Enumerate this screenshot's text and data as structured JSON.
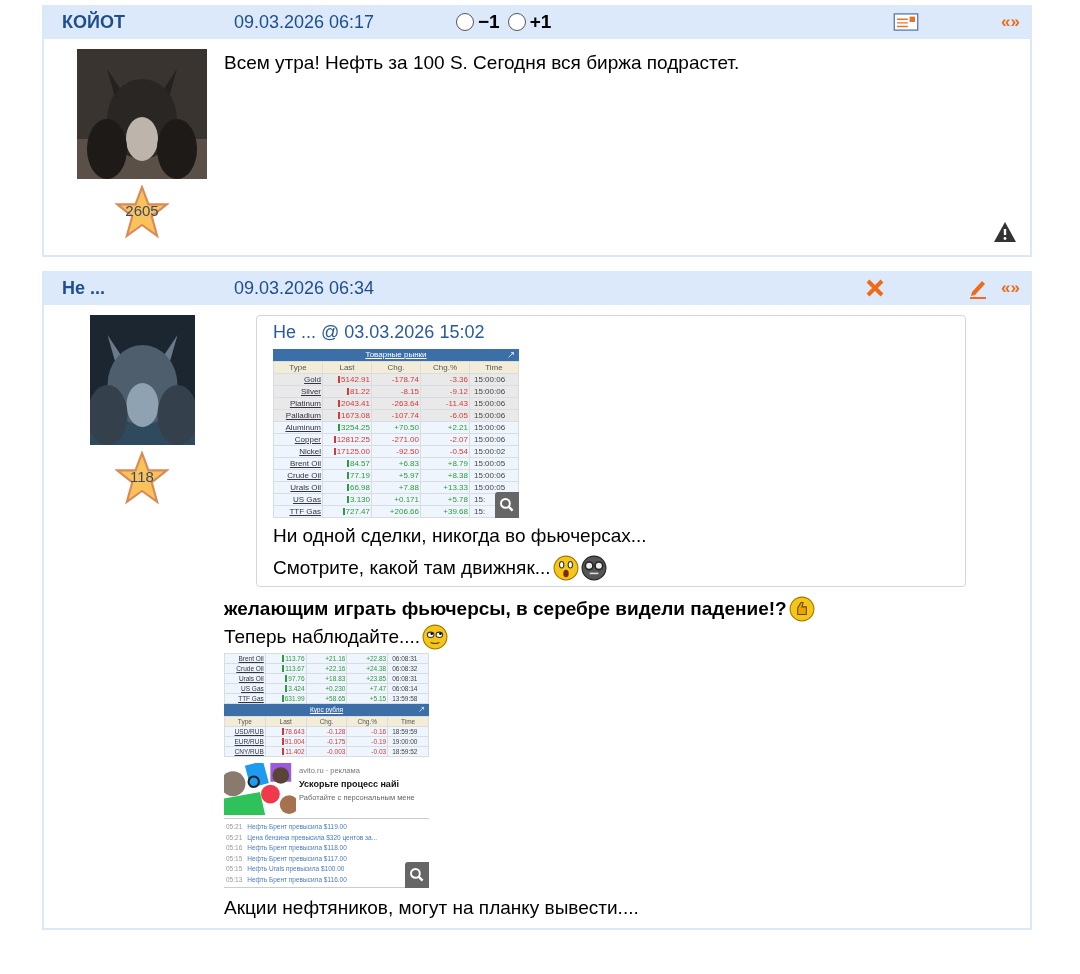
{
  "posts": [
    {
      "author": "КОЙОТ",
      "date": "09.03.2026 06:17",
      "votes": [
        {
          "label": "−1",
          "selected": false
        },
        {
          "label": "+1",
          "selected": false
        }
      ],
      "actions": [
        {
          "kind": "card"
        },
        {
          "kind": "quote",
          "text": "«»"
        }
      ],
      "rating": "2605",
      "footer": [
        {
          "kind": "warning"
        }
      ],
      "blocks": [
        {
          "kind": "text",
          "text": "Всем утра! Нефть за 100 S. Сегодня вся биржа подрастет.",
          "bold": false
        }
      ]
    },
    {
      "author": "Не ...",
      "date": "09.03.2026 06:34",
      "actions": [
        {
          "kind": "delete"
        },
        {
          "kind": "edit"
        },
        {
          "kind": "quote",
          "text": "«»"
        }
      ],
      "rating": "118",
      "blocks": [
        {
          "kind": "quote",
          "heading": "Не ... @ 03.03.2026 15:02",
          "table": {
            "title": "Товарные рынки",
            "columns": [
              "Type",
              "Last",
              "Chg.",
              "Chg.%",
              "Time"
            ],
            "rows": [
              {
                "cells": [
                  "Gold",
                  "5142.91",
                  "-178.74",
                  "-3.36",
                  "15:00:06"
                ],
                "color": "#d23a3a"
              },
              {
                "cells": [
                  "Silver",
                  "81.22",
                  "-8.15",
                  "-9.12",
                  "15:00:06"
                ],
                "color": "#d23a3a"
              },
              {
                "cells": [
                  "Platinum",
                  "2043.41",
                  "-263.64",
                  "-11.43",
                  "15:00:06"
                ],
                "color": "#d23a3a"
              },
              {
                "cells": [
                  "Palladium",
                  "1673.08",
                  "-107.74",
                  "-6.05",
                  "15:00:06"
                ],
                "color": "#d23a3a"
              },
              {
                "cells": [
                  "Aluminum",
                  "3254.25",
                  "+70.50",
                  "+2.21",
                  "15:00:06"
                ],
                "color": "#2f9a3f"
              },
              {
                "cells": [
                  "Copper",
                  "12812.25",
                  "-271.00",
                  "-2.07",
                  "15:00:06"
                ],
                "color": "#d23a3a"
              },
              {
                "cells": [
                  "Nickel",
                  "17125.00",
                  "-92.50",
                  "-0.54",
                  "15:00:02"
                ],
                "color": "#d23a3a"
              },
              {
                "cells": [
                  "Brent Oil",
                  "84.57",
                  "+6.83",
                  "+8.79",
                  "15:00:05"
                ],
                "color": "#2f9a3f"
              },
              {
                "cells": [
                  "Crude Oil",
                  "77.19",
                  "+5.97",
                  "+8.38",
                  "15:00:06"
                ],
                "color": "#2f9a3f"
              },
              {
                "cells": [
                  "Urals Oil",
                  "66.98",
                  "+7.88",
                  "+13.33",
                  "15:00:05"
                ],
                "color": "#2f9a3f"
              },
              {
                "cells": [
                  "US Gas",
                  "3.130",
                  "+0.171",
                  "+5.78",
                  "15:"
                ],
                "color": "#2f9a3f"
              },
              {
                "cells": [
                  "TTF Gas",
                  "727.47",
                  "+206.66",
                  "+39.68",
                  "15:"
                ],
                "color": "#2f9a3f"
              }
            ]
          },
          "lines": [
            {
              "text": "Ни одной сделки, никогда во фьючерсах..."
            },
            {
              "text": "Смотрите, какой там движняк...",
              "emojis": [
                {
                  "kind": "surprised"
                },
                {
                  "kind": "glasses"
                }
              ]
            }
          ]
        },
        {
          "kind": "text",
          "text": "желающим играть фьючерсы, в серебре видели падение!?",
          "bold": true,
          "emojis": [
            {
              "kind": "thumbs"
            }
          ]
        },
        {
          "kind": "text",
          "text": "Теперь наблюдайте....",
          "bold": false,
          "emojis": [
            {
              "kind": "rolling"
            }
          ]
        },
        {
          "kind": "shot",
          "top_rows": [
            {
              "cells": [
                "Brent Oil",
                "113.76",
                "+21.16",
                "+22.83",
                "06:08:31"
              ],
              "color": "#2f9a3f"
            },
            {
              "cells": [
                "Crude Oil",
                "113.67",
                "+22.16",
                "+24.38",
                "06:08:32"
              ],
              "color": "#2f9a3f"
            },
            {
              "cells": [
                "Urals Oil",
                "97.76",
                "+18.83",
                "+23.85",
                "06:08:31"
              ],
              "color": "#2f9a3f"
            },
            {
              "cells": [
                "US Gas",
                "3.424",
                "+0.230",
                "+7.47",
                "06:08:14"
              ],
              "color": "#2f9a3f"
            },
            {
              "cells": [
                "TTF Gas",
                "631.99",
                "+58.65",
                "+5.15",
                "13:59:58"
              ],
              "color": "#2f9a3f"
            }
          ],
          "title": "Курс рубля",
          "columns": [
            "Type",
            "Last",
            "Chg.",
            "Chg.%",
            "Time"
          ],
          "rows": [
            {
              "cells": [
                "USD/RUB",
                "78.643",
                "-0.128",
                "-0.16",
                "18:59:59"
              ],
              "color": "#d23a3a"
            },
            {
              "cells": [
                "EUR/RUB",
                "91.004",
                "-0.175",
                "-0.19",
                "19:00:00"
              ],
              "color": "#d23a3a"
            },
            {
              "cells": [
                "CNY/RUB",
                "11.402",
                "-0.003",
                "-0.03",
                "18:59:52"
              ],
              "color": "#d23a3a"
            }
          ],
          "ad": {
            "source": "avito.ru · реклама",
            "title": "Ускорьте процесс найі",
            "text": "Работайте с персональным мене"
          },
          "news": [
            {
              "time": "05:21",
              "text": "Нефть Брент превысила $119.00"
            },
            {
              "time": "05:21",
              "text": "Цена бензина превысила $320 центов за..."
            },
            {
              "time": "05:16",
              "text": "Нефть Брент превысила $118.00"
            },
            {
              "time": "05:15",
              "text": "Нефть Брент превысила $117.00"
            },
            {
              "time": "05:15",
              "text": "Нефть Urals превысила $100.00"
            },
            {
              "time": "05:13",
              "text": "Нефть Брент превысила $116.00"
            }
          ]
        },
        {
          "kind": "text",
          "text": "Акции нефтяников, могут на планку вывести....",
          "bold": false
        }
      ]
    }
  ]
}
